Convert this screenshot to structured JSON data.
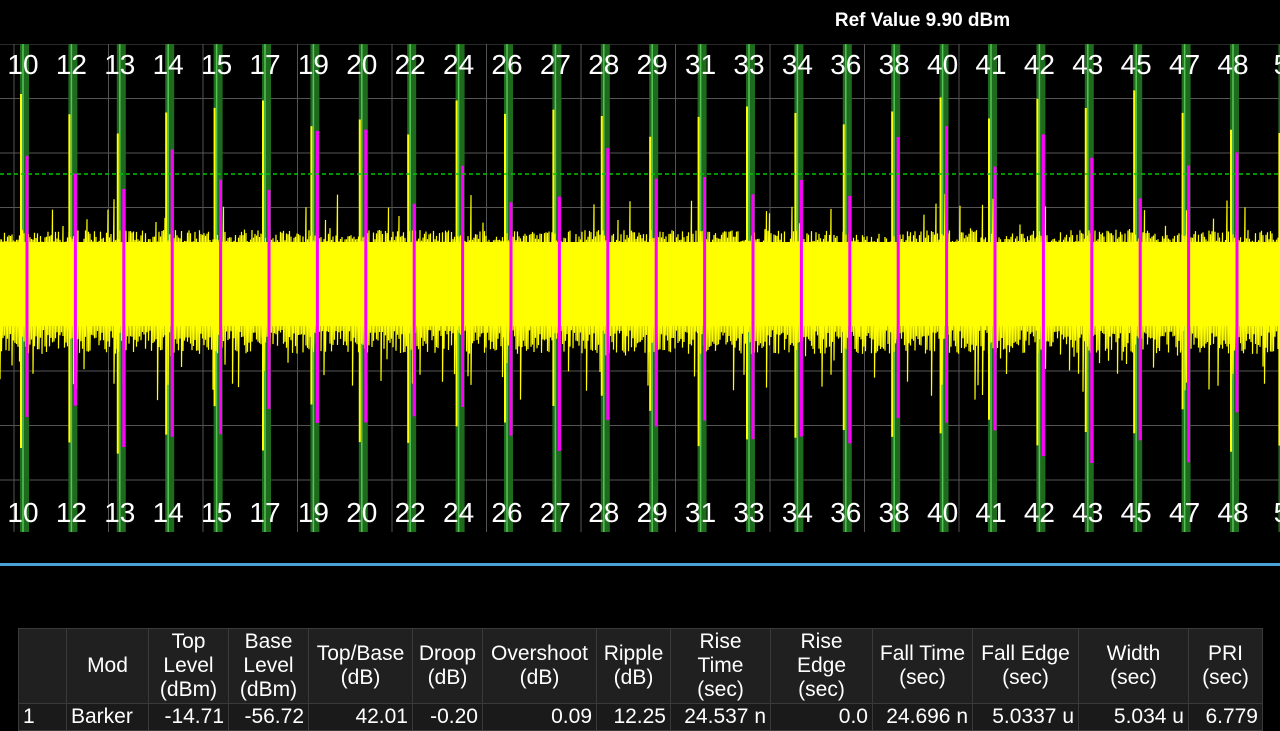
{
  "ref_value": "Ref Value 9.90 dBm",
  "pulse_markers": [
    "10",
    "12",
    "13",
    "14",
    "15",
    "17",
    "19",
    "20",
    "22",
    "24",
    "26",
    "27",
    "28",
    "29",
    "31",
    "33",
    "34",
    "36",
    "38",
    "40",
    "41",
    "42",
    "43",
    "45",
    "47",
    "48",
    "5"
  ],
  "colors": {
    "trace": "#ffff00",
    "pulse_highlight": "#ff00ff",
    "marker_band": "#1e6b1e",
    "marker_line": "#56c456",
    "reference_line": "#00c800",
    "grid": "#555555",
    "divider": "#4aa3d8"
  },
  "table": {
    "headers": [
      "",
      "Mod",
      "Top Level (dBm)",
      "Base Level (dBm)",
      "Top/Base (dB)",
      "Droop (dB)",
      "Overshoot (dB)",
      "Ripple (dB)",
      "Rise Time (sec)",
      "Rise Edge (sec)",
      "Fall Time (sec)",
      "Fall Edge (sec)",
      "Width (sec)",
      "PRI (sec)"
    ],
    "rows": [
      [
        "1",
        "Barker",
        "-14.71",
        "-56.72",
        "42.01",
        "-0.20",
        "0.09",
        "12.25",
        "24.537 n",
        "0.0",
        "24.696 n",
        "5.0337 u",
        "5.034 u",
        "6.779"
      ]
    ]
  }
}
